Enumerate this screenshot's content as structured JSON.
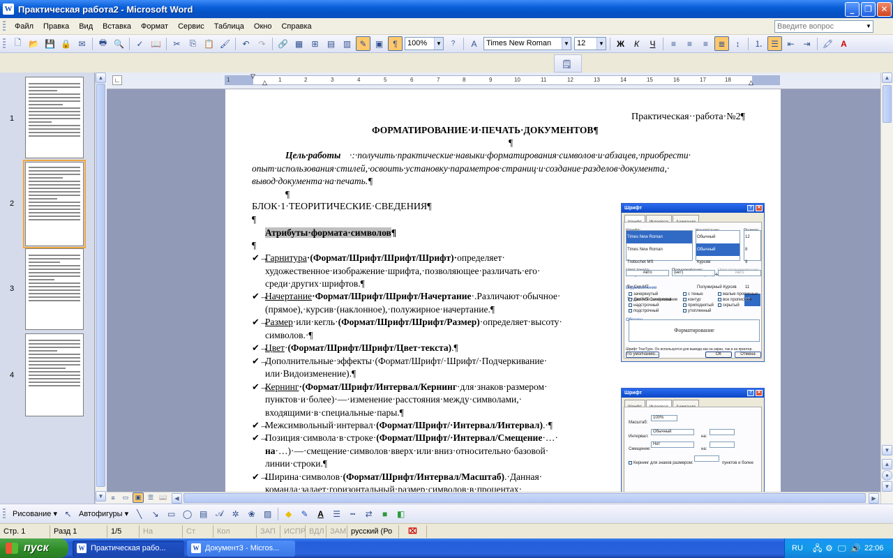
{
  "window": {
    "title": "Практическая  работа2 - Microsoft Word",
    "app_icon": "W"
  },
  "window_controls": {
    "minimize": "_",
    "maximize": "❐",
    "close": "✕"
  },
  "menu": [
    "Файл",
    "Правка",
    "Вид",
    "Вставка",
    "Формат",
    "Сервис",
    "Таблица",
    "Окно",
    "Справка"
  ],
  "ask": {
    "placeholder": "Введите вопрос"
  },
  "toolbar": {
    "zoom": "100%",
    "font": "Times New Roman",
    "size": "12"
  },
  "thumbnails": {
    "pages": [
      "1",
      "2",
      "3",
      "4"
    ],
    "selected": "2"
  },
  "ruler": {
    "labels": [
      "1",
      "1",
      "2",
      "3",
      "4",
      "5",
      "6",
      "7",
      "8",
      "9",
      "10",
      "11",
      "12",
      "13",
      "14",
      "15",
      "16",
      "17",
      "18"
    ]
  },
  "document": {
    "header_right": "Практическая··работа·№2¶",
    "title": "ФОРМАТИРОВАНИЕ·И·ПЕЧАТЬ·ДОКУМЕНТОВ¶",
    "para_mark": "¶",
    "goal_label": "Цель·работы",
    "goal_line1": "·:·получить·практические·навыки·форматирования·символов·и·абзацев,·приобрести·",
    "goal_line2": "опыт·использования·стилей,·освоить·установку·параметров·страниц·и·создание·разделов·документа,·",
    "goal_line3": "вывод·документа·на·печать.¶",
    "block_title": "БЛОК·1·ТЕОРИТИЧЕСКИЕ·СВЕДЕНИЯ¶",
    "attr_heading": "Атрибуты·формата·символов",
    "bullet_glyph": "✔→",
    "items": [
      {
        "u": "Гарнитура",
        "b": "·(Формат/Шрифт/Шрифт/Шрифт)·",
        "t": "определяет·",
        "l2": "художественное·изображение·шрифта,·позволяющее·различать·его·",
        "l3": "среди·других·шрифтов.¶"
      },
      {
        "u": "Начертание",
        "b": "·Формат/Шрифт/Шрифт/Начертание",
        "t": "·.Различают·обычное·",
        "l2": "(прямое),·курсив·(наклонное),·полужирное·начертание.¶"
      },
      {
        "u": "Размер",
        "t": "·или·кегль·",
        "b": "(Формат/Шрифт/Шрифт/Размер)",
        "t2": "·определяет·высоту·",
        "l2": "символов.·¶"
      },
      {
        "u": "Цвет",
        "t": "·",
        "b": "(Формат/Шрифт/Шрифт/Цвет·текста)",
        "t2": ".¶"
      },
      {
        "t": "Дополнительные·эффекты·(Формат/Шрифт/·Шрифт/·Подчеркивание·",
        "l2": "или·Видоизменение).¶"
      },
      {
        "u": "Кернинг",
        "b": "·(Формат/Шрифт/Интервал/Кернинг",
        "t": "·для·знаков·размером·",
        "l2": "пунктов·и·более)·—·изменение·расстояния·между·символами,·",
        "l3": "входящими·в·специальные·пары.¶"
      },
      {
        "t": "Межсимвольный·интервал·",
        "b": "(Формат/Шрифт/·Интервал/Интервал)",
        "t2": ".·¶"
      },
      {
        "t": "Позиция·символа·в·строке·",
        "b": "(Формат/Шрифт/·Интервал/Смещение",
        "t2": "·…·",
        "l2b": "на",
        "l2": "·…)·—·смещение·символов·вверх·или·вниз·относительно·базовой·",
        "l3": "линии·строки.¶"
      },
      {
        "t": "Ширина·символов·",
        "b": "(Формат/Шрифт/Интервал/Масштаб)",
        "t2": ".·Данная·",
        "l2": "команда·задает·горизонтальный·размер·символов·в·процентах·"
      }
    ]
  },
  "font_dialog": {
    "title": "Шрифт",
    "tabs": [
      "Шрифт",
      "Интервал",
      "Анимация"
    ],
    "font_label": "Шрифт:",
    "style_label": "Начертание:",
    "size_label": "Размер:",
    "font_value": "Times New Roman",
    "style_value": "Обычный",
    "size_value": "12",
    "font_list": [
      "Times New Roman",
      "Trebuchet MS",
      "Tunga",
      "Tw Cen MT",
      "Tw Cen MT Condensed"
    ],
    "style_list": [
      "Обычный",
      "Курсив",
      "Полужирный",
      "Полужирный Курсив"
    ],
    "size_list": [
      "8",
      "9",
      "10",
      "11",
      "12"
    ],
    "color_label": "Цвет текста:",
    "underline_label": "Подчеркивание:",
    "ucolor_label": "Цвет подчеркивания:",
    "color_value": "Авто",
    "underline_value": "(нет)",
    "ucolor_value": "Авто",
    "effects_label": "Видоизменение",
    "effects": [
      "зачеркнутый",
      "двойное зачеркивание",
      "надстрочный",
      "подстрочный",
      "с тенью",
      "контур",
      "приподнятый",
      "утопленный",
      "малые прописные",
      "все прописные",
      "скрытый"
    ],
    "sample_label": "Образец",
    "sample_text": "Форматирование",
    "note": "Шрифт TrueType. Он используется для вывода как на экран, так и на принтер.",
    "default_btn": "По умолчанию...",
    "ok": "ОК",
    "cancel": "Отмена"
  },
  "interval_dialog": {
    "title": "Шрифт",
    "tabs": [
      "Шрифт",
      "Интервал",
      "Анимация"
    ],
    "scale_label": "Масштаб:",
    "scale_value": "100%",
    "spacing_label": "Интервал:",
    "spacing_value": "Обычный",
    "on_label": "на:",
    "offset_label": "Смещение:",
    "offset_value": "Нет",
    "by_label": "на:",
    "kern_label": "Кернинг для знаков размером:",
    "kern_suffix": "пунктов и более"
  },
  "drawing_toolbar": {
    "draw": "Рисование ▾",
    "autoshapes": "Автофигуры ▾"
  },
  "status": {
    "page": "Стр.  1",
    "section": "Разд  1",
    "pages": "1/5",
    "at": "На",
    "line": "Ст",
    "col": "Кол",
    "rec": "ЗАП",
    "trk": "ИСПР",
    "ext": "ВДЛ",
    "ovr": "ЗАМ",
    "lang": "русский (Ро"
  },
  "taskbar": {
    "start": "пуск",
    "tasks": [
      "Практическая рабо...",
      "Документ3 - Micros..."
    ],
    "lang": "RU",
    "clock": "22:06"
  },
  "colors": {
    "accent": "#0a5fd8",
    "taskbar": "#245edb",
    "start": "#2d8a26"
  }
}
